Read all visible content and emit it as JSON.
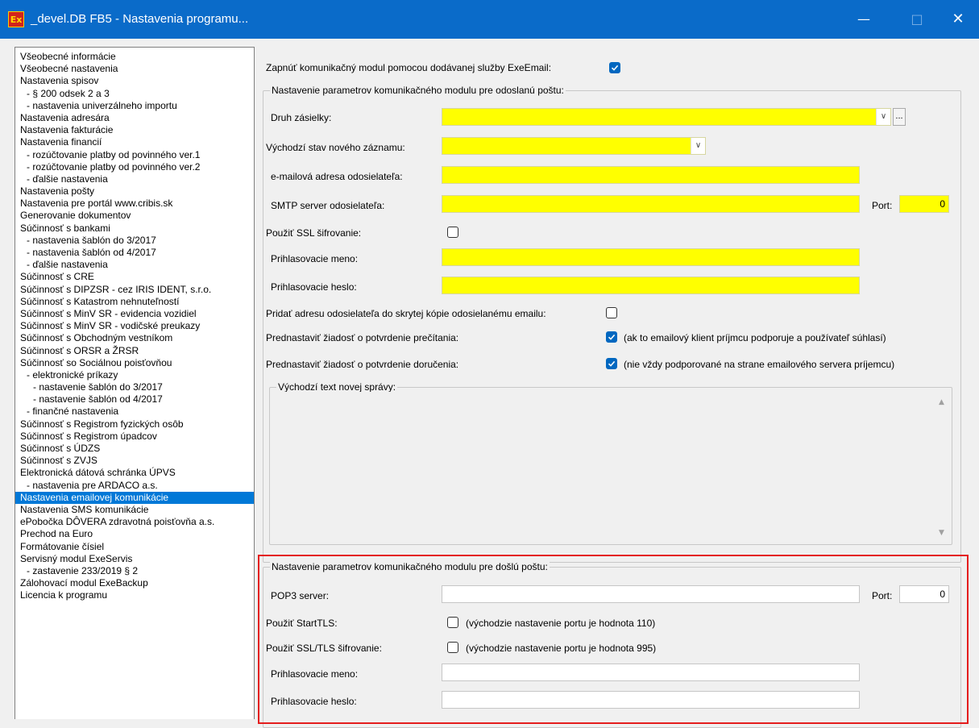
{
  "window": {
    "app_icon_text": "Ex",
    "title": "_devel.DB FB5 - Nastavenia programu..."
  },
  "nav": {
    "items": [
      {
        "label": "Všeobecné informácie",
        "level": 0
      },
      {
        "label": "Všeobecné nastavenia",
        "level": 0
      },
      {
        "label": "Nastavenia spisov",
        "level": 0
      },
      {
        "label": "- § 200 odsek 2 a 3",
        "level": 1
      },
      {
        "label": "- nastavenia univerzálneho importu",
        "level": 1
      },
      {
        "label": "Nastavenia adresára",
        "level": 0
      },
      {
        "label": "Nastavenia fakturácie",
        "level": 0
      },
      {
        "label": "Nastavenia financií",
        "level": 0
      },
      {
        "label": "- rozúčtovanie platby od povinného ver.1",
        "level": 1
      },
      {
        "label": "- rozúčtovanie platby od povinného ver.2",
        "level": 1
      },
      {
        "label": "- ďalšie nastavenia",
        "level": 1
      },
      {
        "label": "Nastavenia pošty",
        "level": 0
      },
      {
        "label": "Nastavenia pre portál www.cribis.sk",
        "level": 0
      },
      {
        "label": "Generovanie dokumentov",
        "level": 0
      },
      {
        "label": "Súčinnosť s bankami",
        "level": 0
      },
      {
        "label": "- nastavenia šablón do 3/2017",
        "level": 1
      },
      {
        "label": "- nastavenia šablón od 4/2017",
        "level": 1
      },
      {
        "label": "- ďalšie nastavenia",
        "level": 1
      },
      {
        "label": "Súčinnosť s CRE",
        "level": 0
      },
      {
        "label": "Súčinnosť s DIPZSR - cez IRIS IDENT, s.r.o.",
        "level": 0
      },
      {
        "label": "Súčinnosť s Katastrom nehnuteľností",
        "level": 0
      },
      {
        "label": "Súčinnosť s MinV SR - evidencia vozidiel",
        "level": 0
      },
      {
        "label": "Súčinnosť s MinV SR - vodičské preukazy",
        "level": 0
      },
      {
        "label": "Súčinnosť s Obchodným vestníkom",
        "level": 0
      },
      {
        "label": "Súčinnosť s ORSR a ŽRSR",
        "level": 0
      },
      {
        "label": "Súčinnosť so Sociálnou poisťovňou",
        "level": 0
      },
      {
        "label": "- elektronické príkazy",
        "level": 1
      },
      {
        "label": "- nastavenie šablón do 3/2017",
        "level": 2
      },
      {
        "label": "- nastavenie šablón od 4/2017",
        "level": 2
      },
      {
        "label": "- finančné nastavenia",
        "level": 1
      },
      {
        "label": "Súčinnosť s Registrom fyzických osôb",
        "level": 0
      },
      {
        "label": "Súčinnosť s Registrom úpadcov",
        "level": 0
      },
      {
        "label": "Súčinnosť s ÚDZS",
        "level": 0
      },
      {
        "label": "Súčinnosť s ZVJS",
        "level": 0
      },
      {
        "label": "Elektronická dátová schránka ÚPVS",
        "level": 0
      },
      {
        "label": "- nastavenia pre ARDACO a.s.",
        "level": 1
      },
      {
        "label": "Nastavenia emailovej komunikácie",
        "level": 0,
        "selected": true
      },
      {
        "label": "Nastavenia SMS komunikácie",
        "level": 0
      },
      {
        "label": "ePobočka DÔVERA zdravotná poisťovňa a.s.",
        "level": 0
      },
      {
        "label": "Prechod na Euro",
        "level": 0
      },
      {
        "label": "Formátovanie čísiel",
        "level": 0
      },
      {
        "label": "Servisný modul ExeServis",
        "level": 0
      },
      {
        "label": "- zastavenie 233/2019 § 2",
        "level": 1
      },
      {
        "label": "Zálohovací modul ExeBackup",
        "level": 0
      },
      {
        "label": "Licencia k programu",
        "level": 0
      }
    ]
  },
  "top": {
    "enable_label": "Zapnúť komunikačný modul pomocou dodávanej služby ExeEmail:",
    "enable_checked": true
  },
  "outgoing": {
    "title": "Nastavenie parametrov komunikačného modulu pre odoslanú poštu:",
    "druh_label": "Druh zásielky:",
    "druh_value": "",
    "druh_ellipsis": "...",
    "stav_label": "Východzí stav nového záznamu:",
    "stav_value": "",
    "email_label": "e-mailová adresa odosielateľa:",
    "email_value": "",
    "smtp_label": "SMTP server odosielateľa:",
    "smtp_value": "",
    "port_label": "Port:",
    "port_value": "0",
    "ssl_label": "Použiť SSL šifrovanie:",
    "ssl_checked": false,
    "login_label": "Prihlasovacie meno:",
    "login_value": "",
    "pass_label": "Prihlasovacie heslo:",
    "pass_value": "",
    "bcc_label": "Pridať adresu odosielateľa do skrytej kópie odosielanému emailu:",
    "bcc_checked": false,
    "read_label": "Prednastaviť žiadosť o potvrdenie prečítania:",
    "read_checked": true,
    "read_note": "(ak to emailový klient príjmcu podporuje a používateľ súhlasí)",
    "delivery_label": "Prednastaviť žiadosť o potvrdenie doručenia:",
    "delivery_checked": true,
    "delivery_note": "(nie vždy podporované na strane emailového servera príjemcu)",
    "default_text_title": "Východzí text novej správy:",
    "default_text_value": ""
  },
  "incoming": {
    "title": "Nastavenie parametrov komunikačného modulu pre došlú poštu:",
    "pop3_label": "POP3 server:",
    "pop3_value": "",
    "port_label": "Port:",
    "port_value": "0",
    "starttls_label": "Použiť StartTLS:",
    "starttls_checked": false,
    "starttls_note": "(východzie nastavenie portu je hodnota 110)",
    "ssltls_label": "Použiť SSL/TLS šifrovanie:",
    "ssltls_checked": false,
    "ssltls_note": "(východzie nastavenie portu je hodnota 995)",
    "login_label": "Prihlasovacie meno:",
    "login_value": "",
    "pass_label": "Prihlasovacie heslo:",
    "pass_value": ""
  },
  "colors": {
    "titlebar": "#0a6bc9",
    "required_field": "#ffff00",
    "selection": "#0078d7",
    "highlight_box": "#e41d1d",
    "checkbox_on": "#0067c0"
  }
}
